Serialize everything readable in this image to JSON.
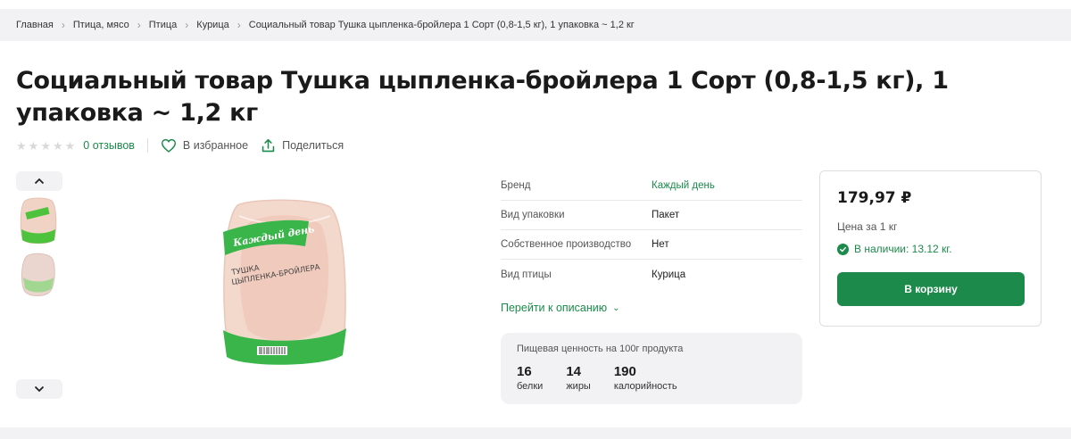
{
  "breadcrumb": {
    "items": [
      "Главная",
      "Птица, мясо",
      "Птица",
      "Курица"
    ],
    "current": "Социальный товар Тушка цыпленка-бройлера 1 Сорт (0,8-1,5 кг), 1 упаковка ~ 1,2 кг",
    "separator": "›"
  },
  "product": {
    "title": "Социальный товар Тушка цыпленка-бройлера 1 Сорт (0,8-1,5 кг), 1 упаковка ~ 1,2 кг",
    "rating": 0,
    "reviews_label": "0 отзывов",
    "favorite_label": "В избранное",
    "share_label": "Поделиться"
  },
  "package_print": {
    "brand": "Каждый день",
    "line1": "ТУШКА",
    "line2": "ЦЫПЛЕНКА-БРОЙЛЕРА"
  },
  "attributes": [
    {
      "key": "Бренд",
      "value": "Каждый день",
      "link": true
    },
    {
      "key": "Вид упаковки",
      "value": "Пакет",
      "link": false
    },
    {
      "key": "Собственное производство",
      "value": "Нет",
      "link": false
    },
    {
      "key": "Вид птицы",
      "value": "Курица",
      "link": false
    }
  ],
  "description_link": "Перейти к описанию",
  "nutrition": {
    "title": "Пищевая ценность на 100г продукта",
    "items": [
      {
        "value": "16",
        "label": "белки"
      },
      {
        "value": "14",
        "label": "жиры"
      },
      {
        "value": "190",
        "label": "калорийность"
      }
    ]
  },
  "purchase": {
    "price": "179,97 ₽",
    "unit": "Цена за 1 кг",
    "stock": "В наличии: 13.12 кг.",
    "cart_label": "В корзину"
  },
  "colors": {
    "accent": "#1b8a4a",
    "background_gray": "#f2f2f4"
  },
  "icons": [
    "chevron-up-icon",
    "chevron-down-icon",
    "heart-icon",
    "share-icon",
    "check-circle-icon",
    "star-icon"
  ]
}
